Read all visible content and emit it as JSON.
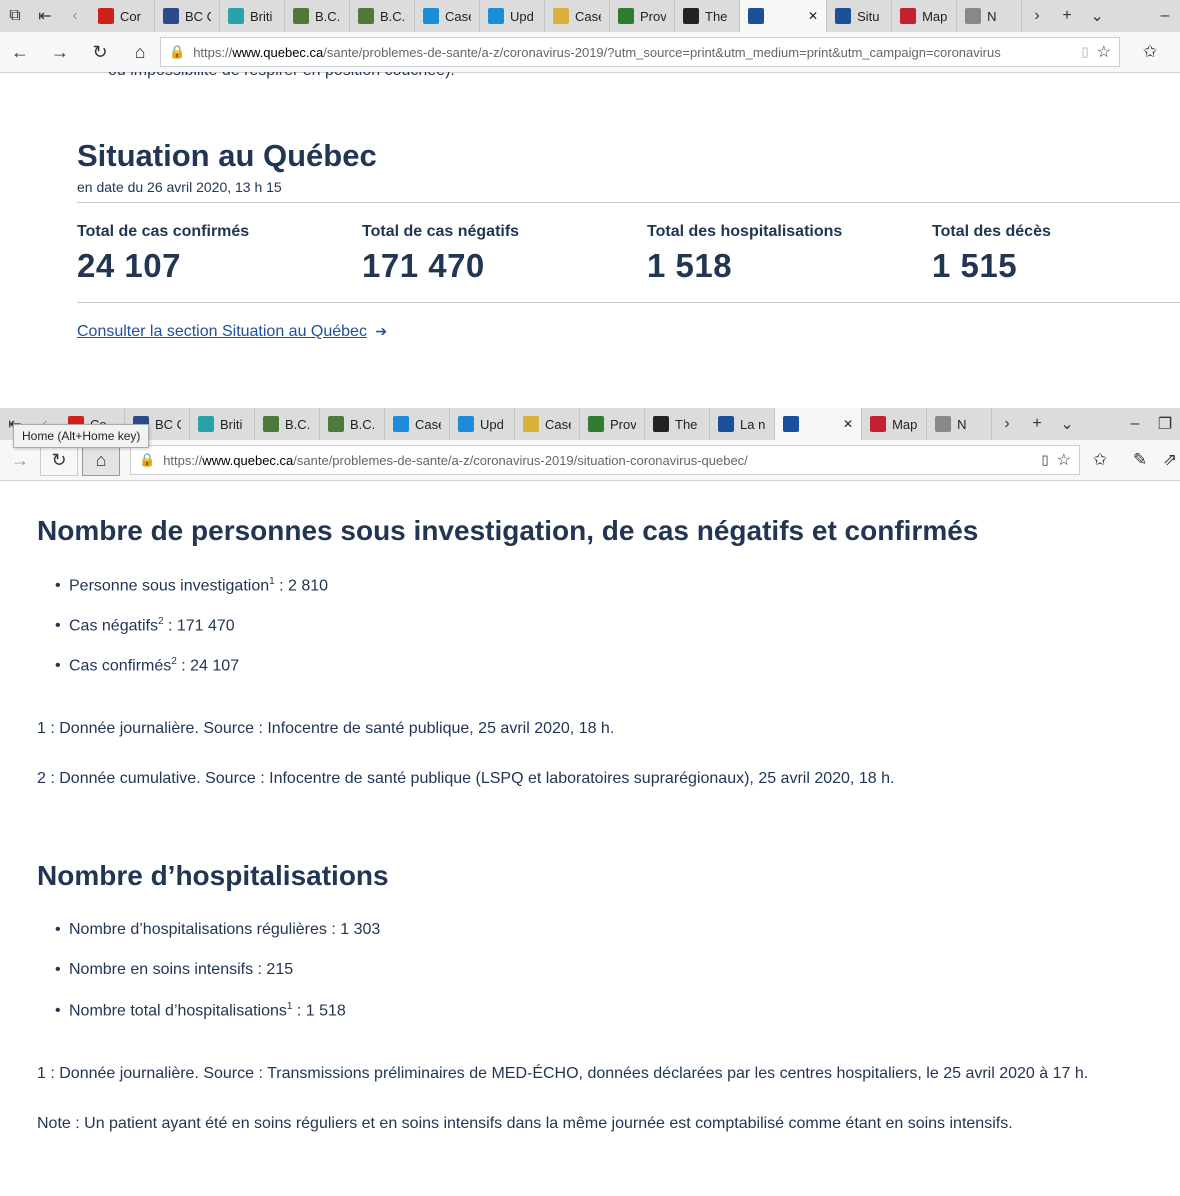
{
  "browser1": {
    "tabs": [
      {
        "title": "Cor",
        "color": "#d0201c",
        "icon": "maple-leaf-icon"
      },
      {
        "title": "BC C",
        "color": "#2b4a8b",
        "icon": "bc-icon"
      },
      {
        "title": "Briti",
        "color": "#27a2a8",
        "icon": "bc-gov-icon"
      },
      {
        "title": "B.C.",
        "color": "#4d7a3a",
        "icon": "globe-icon"
      },
      {
        "title": "B.C.",
        "color": "#4d7a3a",
        "icon": "globe-icon"
      },
      {
        "title": "Case",
        "color": "#1c8bd8",
        "icon": "chart-icon"
      },
      {
        "title": "Upd",
        "color": "#1c8bd8",
        "icon": "chart-icon"
      },
      {
        "title": "Case",
        "color": "#d9b03a",
        "icon": "doc-icon"
      },
      {
        "title": "Prov",
        "color": "#2e7d32",
        "icon": "flag-icon"
      },
      {
        "title": "The",
        "color": "#222222",
        "icon": "shield-icon"
      },
      {
        "title": "",
        "color": "#1a4f9c",
        "icon": "fleur-de-lis-icon",
        "active": true
      },
      {
        "title": "Situ",
        "color": "#1a4f9c",
        "icon": "fleur-de-lis-icon"
      },
      {
        "title": "Map",
        "color": "#c2202f",
        "icon": "map-icon"
      },
      {
        "title": "N",
        "color": "#888888",
        "icon": "news-icon"
      }
    ],
    "url_prefix": "https://",
    "url_host": "www.quebec.ca",
    "url_rest": "/sante/problemes-de-sante/a-z/coronavirus-2019/?utm_source=print&utm_medium=print&utm_campaign=coronavirus"
  },
  "page1": {
    "cut_text": "ou impossibilité de respirer en position couchée).",
    "title": "Situation au Québec",
    "date": "en date du 26 avril 2020, 13 h 15",
    "stats": [
      {
        "label": "Total de cas confirmés",
        "value": "24 107"
      },
      {
        "label": "Total de cas négatifs",
        "value": "171 470"
      },
      {
        "label": "Total des hospitalisations",
        "value": "1 518"
      },
      {
        "label": "Total des décès",
        "value": "1 515"
      }
    ],
    "link": "Consulter la section Situation au Québec",
    "link_arrow": "➔"
  },
  "browser2": {
    "tabs": [
      {
        "title": "Co",
        "color": "#d0201c",
        "icon": "maple-leaf-icon"
      },
      {
        "title": "BC C",
        "color": "#2b4a8b",
        "icon": "bc-icon"
      },
      {
        "title": "Briti",
        "color": "#27a2a8",
        "icon": "bc-gov-icon"
      },
      {
        "title": "B.C.",
        "color": "#4d7a3a",
        "icon": "globe-icon"
      },
      {
        "title": "B.C.",
        "color": "#4d7a3a",
        "icon": "globe-icon"
      },
      {
        "title": "Case",
        "color": "#1c8bd8",
        "icon": "chart-icon"
      },
      {
        "title": "Upd",
        "color": "#1c8bd8",
        "icon": "chart-icon"
      },
      {
        "title": "Case",
        "color": "#d9b03a",
        "icon": "doc-icon"
      },
      {
        "title": "Prov",
        "color": "#2e7d32",
        "icon": "flag-icon"
      },
      {
        "title": "The",
        "color": "#222222",
        "icon": "shield-icon"
      },
      {
        "title": "La n",
        "color": "#1a4f9c",
        "icon": "fleur-de-lis-icon"
      },
      {
        "title": "",
        "color": "#1a4f9c",
        "icon": "fleur-de-lis-icon",
        "active": true
      },
      {
        "title": "Map",
        "color": "#c2202f",
        "icon": "map-icon"
      },
      {
        "title": "N",
        "color": "#888888",
        "icon": "news-icon"
      }
    ],
    "url_prefix": "https://",
    "url_host": "www.quebec.ca",
    "url_rest": "/sante/problemes-de-sante/a-z/coronavirus-2019/situation-coronavirus-quebec/",
    "tooltip": "Home (Alt+Home key)"
  },
  "page2": {
    "section1": {
      "title": "Nombre de personnes sous investigation, de cas négatifs et confirmés",
      "items": [
        {
          "label": "Personne sous investigation",
          "sup": "1",
          "value": " : 2 810"
        },
        {
          "label": "Cas négatifs",
          "sup": "2",
          "value": " : 171 470"
        },
        {
          "label": "Cas confirmés",
          "sup": "2",
          "value": " : 24 107"
        }
      ],
      "notes": [
        "1 : Donnée journalière. Source : Infocentre de santé publique, 25 avril 2020, 18 h.",
        "2 : Donnée cumulative. Source : Infocentre de santé publique (LSPQ et laboratoires suprarégionaux), 25 avril 2020, 18 h."
      ]
    },
    "section2": {
      "title": "Nombre d’hospitalisations",
      "items": [
        {
          "label": "Nombre d’hospitalisations régulières",
          "sup": "",
          "value": " : 1 303"
        },
        {
          "label": "Nombre en soins intensifs",
          "sup": "",
          "value": " : 215"
        },
        {
          "label": "Nombre total d’hospitalisations",
          "sup": "1",
          "value": " : 1 518"
        }
      ],
      "notes": [
        "1 : Donnée journalière. Source : Transmissions préliminaires de MED-ÉCHO, données déclarées par les centres hospitaliers, le 25 avril 2020 à 17 h.",
        "Note : Un patient ayant été en soins réguliers et en soins intensifs dans la même journée est comptabilisé comme étant en soins intensifs."
      ]
    }
  }
}
